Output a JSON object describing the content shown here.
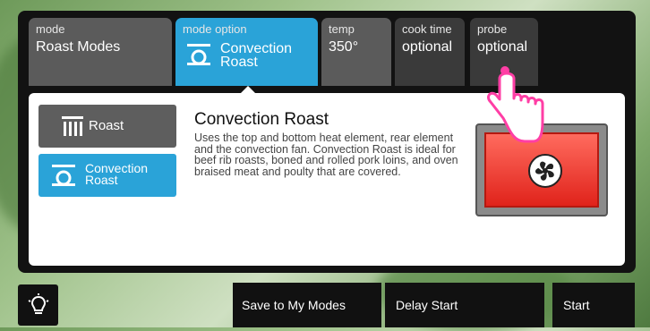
{
  "tabs": [
    {
      "label": "mode",
      "value": "Roast Modes"
    },
    {
      "label": "mode option",
      "value_line1": "Convection",
      "value_line2": "Roast"
    },
    {
      "label": "temp",
      "value": "350°"
    },
    {
      "label": "cook time",
      "value": "optional"
    },
    {
      "label": "probe",
      "value": "optional"
    }
  ],
  "options": [
    {
      "label": "Roast"
    },
    {
      "label_line1": "Convection",
      "label_line2": "Roast"
    }
  ],
  "detail": {
    "title": "Convection Roast",
    "description": "Uses the top and bottom heat element, rear element and the convection fan. Convection Roast is ideal for beef rib roasts, boned and rolled pork loins, and oven braised meat and poulty that are covered."
  },
  "bottom": {
    "save": "Save to My Modes",
    "delay": "Delay Start",
    "start": "Start"
  },
  "colors": {
    "accent": "#2aa3d8",
    "tab_gray": "#5b5b5b",
    "tab_dark": "#3a3a3a",
    "oven_red": "#e0231b"
  },
  "icons": [
    "light-icon",
    "convection-icon",
    "roast-bars-icon",
    "fan-icon",
    "pointing-hand-icon"
  ]
}
